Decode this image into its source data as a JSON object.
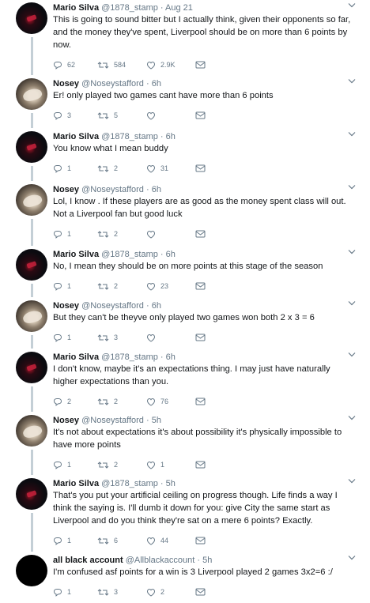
{
  "tweets": [
    {
      "name": "Mario Silva",
      "handle": "@1878_stamp",
      "time": "· Aug 21",
      "avatar": "mario",
      "text": "This is going to sound bitter but I actually think, given their opponents so far, and the money they've spent, Liverpool should be on more than 6 points by now.",
      "replies": "62",
      "retweets": "584",
      "likes": "2.9K"
    },
    {
      "name": "Nosey",
      "handle": "@Noseystafford",
      "time": "· 6h",
      "avatar": "nosey",
      "text": "Er! only played two games cant have more than 6 points",
      "replies": "3",
      "retweets": "5",
      "likes": ""
    },
    {
      "name": "Mario Silva",
      "handle": "@1878_stamp",
      "time": "· 6h",
      "avatar": "mario",
      "text": "You know what I mean buddy",
      "replies": "1",
      "retweets": "2",
      "likes": "31"
    },
    {
      "name": "Nosey",
      "handle": "@Noseystafford",
      "time": "· 6h",
      "avatar": "nosey",
      "text": "Lol, I know . If these players are as good as the money spent class will out. Not a Liverpool fan but good luck",
      "replies": "1",
      "retweets": "2",
      "likes": ""
    },
    {
      "name": "Mario Silva",
      "handle": "@1878_stamp",
      "time": "· 6h",
      "avatar": "mario",
      "text": "No, I mean they should be on more points at this stage of the season",
      "replies": "1",
      "retweets": "2",
      "likes": "23"
    },
    {
      "name": "Nosey",
      "handle": "@Noseystafford",
      "time": "· 6h",
      "avatar": "nosey",
      "text": "But they can't be theyve only played two games won both 2 x 3 = 6",
      "replies": "1",
      "retweets": "3",
      "likes": ""
    },
    {
      "name": "Mario Silva",
      "handle": "@1878_stamp",
      "time": "· 6h",
      "avatar": "mario",
      "text": "I don't know, maybe it's an expectations thing. I may just have naturally higher expectations than you.",
      "replies": "2",
      "retweets": "2",
      "likes": "76"
    },
    {
      "name": "Nosey",
      "handle": "@Noseystafford",
      "time": "· 5h",
      "avatar": "nosey",
      "text": "It's not about expectations it's about possibility it's physically impossible to have more points",
      "replies": "1",
      "retweets": "2",
      "likes": "1"
    },
    {
      "name": "Mario Silva",
      "handle": "@1878_stamp",
      "time": "· 5h",
      "avatar": "mario",
      "text": "That's you put your artificial ceiling on progress though. Life finds a way I think the saying is. I'll dumb it down for you: give City the same start as Liverpool and do you think they're sat on a mere 6 points? Exactly.",
      "replies": "1",
      "retweets": "6",
      "likes": "44"
    },
    {
      "name": "all black account",
      "handle": "@Allblackaccount",
      "time": "· 5h",
      "avatar": "black",
      "text": "I'm confused asf points for a win is 3 Liverpool played 2 games 3x2=6 :/",
      "replies": "1",
      "retweets": "3",
      "likes": "2"
    }
  ],
  "icons": {
    "reply": "reply-icon",
    "retweet": "retweet-icon",
    "like": "like-icon",
    "dm": "direct-message-icon",
    "caret": "chevron-down-icon"
  },
  "colors": {
    "text": "#14171a",
    "meta": "#657786",
    "thread_line": "#c4cfd6"
  }
}
